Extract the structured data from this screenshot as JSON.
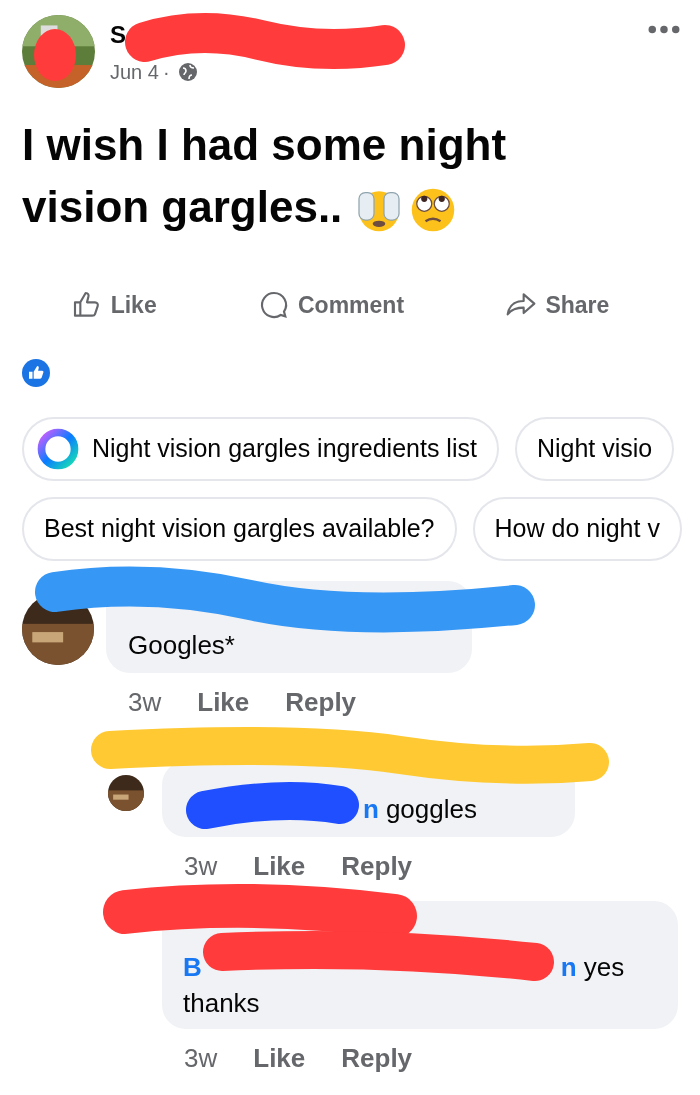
{
  "post": {
    "author": "S",
    "date": "Jun 4",
    "date_separator": "·",
    "text_lines": [
      "I wish I had some night",
      "vision gargles.."
    ],
    "actions": [
      "Like",
      "Comment",
      "Share"
    ]
  },
  "suggestions": [
    [
      {
        "text": "Night vision gargles ingredients list",
        "kind": "ai"
      },
      {
        "text": "Night visio",
        "kind": "plain"
      }
    ],
    [
      {
        "text": "Best night vision gargles available?",
        "kind": "plain"
      },
      {
        "text": "How do night v",
        "kind": "plain"
      }
    ]
  ],
  "comments": [
    {
      "body": [
        {
          "kind": "text",
          "text": "Googles*"
        }
      ],
      "time": "3w",
      "actions": [
        "Like",
        "Reply"
      ],
      "children": [
        {
          "body": [
            {
              "kind": "gap"
            },
            {
              "kind": "mention",
              "text": "n"
            },
            {
              "kind": "text",
              "text": "goggles"
            }
          ],
          "time": "3w",
          "actions": [
            "Like",
            "Reply"
          ]
        },
        {
          "body": [
            {
              "kind": "mention",
              "text": "B"
            },
            {
              "kind": "gap"
            },
            {
              "kind": "mention",
              "text": "n"
            },
            {
              "kind": "text",
              "text": "yes"
            },
            {
              "kind": "text",
              "text": "thanks"
            }
          ],
          "time": "3w",
          "actions": [
            "Like",
            "Reply"
          ]
        }
      ]
    }
  ]
}
